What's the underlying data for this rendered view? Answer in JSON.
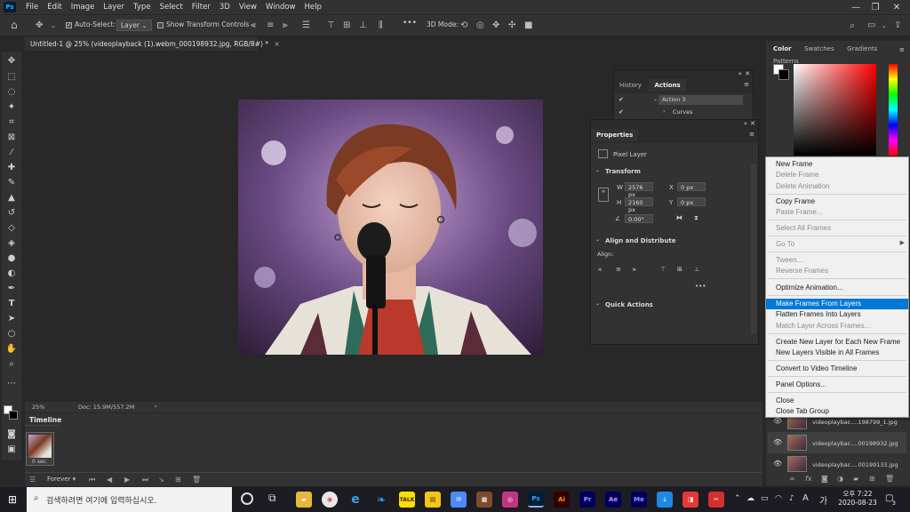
{
  "menubar": {
    "app_icon": "Ps",
    "items": [
      "File",
      "Edit",
      "Image",
      "Layer",
      "Type",
      "Select",
      "Filter",
      "3D",
      "View",
      "Window",
      "Help"
    ]
  },
  "options": {
    "auto_select_label": "Auto-Select:",
    "auto_select_value": "Layer",
    "show_transform_label": "Show Transform Controls",
    "more": "•••",
    "mode_3d_label": "3D Mode:"
  },
  "document": {
    "tab_title": "Untitled-1 @ 25% (videoplayback (1).webm_000198932.jpg, RGB/8#) *",
    "close": "×",
    "zoom": "25%",
    "doc_size": "Doc: 15.9M/557.2M"
  },
  "timeline": {
    "tab_label": "Timeline",
    "frame_delay": "0 sec.",
    "loop": "Forever"
  },
  "history_panel": {
    "tabs": [
      "History",
      "Actions"
    ],
    "actions": [
      "Action 3",
      "Curves"
    ]
  },
  "properties": {
    "tab": "Properties",
    "kind": "Pixel Layer",
    "transform_title": "Transform",
    "w_label": "W",
    "w_value": "2576 px",
    "h_label": "H",
    "h_value": "2160 px",
    "x_label": "X",
    "x_value": "0 px",
    "y_label": "Y",
    "y_value": "0 px",
    "angle_value": "0.00°",
    "align_title": "Align and Distribute",
    "align_label": "Align:",
    "more": "•••",
    "quick_title": "Quick Actions"
  },
  "right_dock": {
    "tabs": [
      "Color",
      "Swatches",
      "Gradients",
      "Patterns"
    ]
  },
  "context_menu": [
    {
      "label": "New Frame",
      "disabled": false
    },
    {
      "label": "Delete Frame",
      "disabled": true
    },
    {
      "label": "Delete Animation",
      "disabled": true
    },
    {
      "label": "Copy Frame",
      "disabled": false
    },
    {
      "label": "Paste Frame...",
      "disabled": true
    },
    {
      "label": "Select All Frames",
      "disabled": true
    },
    {
      "label": "Go To",
      "disabled": true
    },
    {
      "label": "Tween...",
      "disabled": true
    },
    {
      "label": "Reverse Frames",
      "disabled": true
    },
    {
      "label": "Optimize Animation...",
      "disabled": false
    },
    {
      "label": "Make Frames From Layers",
      "disabled": false,
      "highlighted": true
    },
    {
      "label": "Flatten Frames Into Layers",
      "disabled": false
    },
    {
      "label": "Match Layer Across Frames...",
      "disabled": true
    },
    {
      "label": "Create New Layer for Each New Frame",
      "disabled": false
    },
    {
      "label": "New Layers Visible in All Frames",
      "disabled": false
    },
    {
      "label": "Convert to Video Timeline",
      "disabled": false
    },
    {
      "label": "Panel Options...",
      "disabled": false
    },
    {
      "label": "Close",
      "disabled": false
    },
    {
      "label": "Close Tab Group",
      "disabled": false
    }
  ],
  "layers": [
    "videoplaybac....198799_1.jpg",
    "videoplaybac....00198932.jpg",
    "videoplaybac....00199133.jpg"
  ],
  "taskbar": {
    "search_placeholder": "검색하려면 여기에 입력하십시오.",
    "time": "오후 7:22",
    "date": "2020-08-23",
    "ime": "가",
    "notifications": "3",
    "apps": [
      "Ps",
      "Ai",
      "Pr",
      "Ae",
      "Me"
    ]
  },
  "colors": {
    "accent": "#0078d7",
    "ps_blue": "#31a8ff",
    "panel_bg": "#323232"
  }
}
